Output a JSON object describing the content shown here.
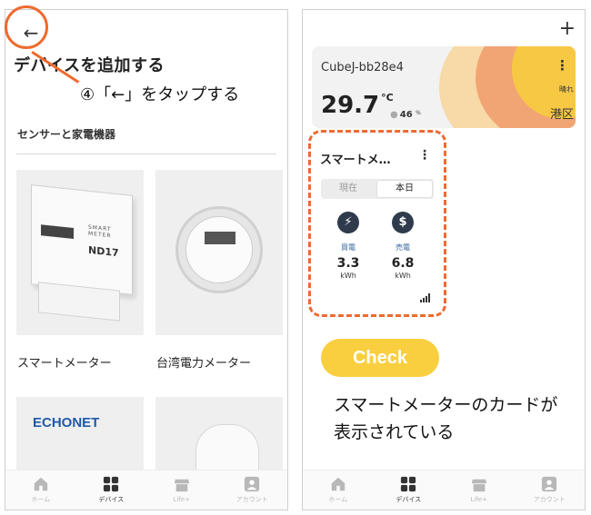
{
  "left": {
    "back_icon": "back-arrow-icon",
    "back_glyph": "←",
    "title": "デバイスを追加する",
    "section_title": "センサーと家電機器",
    "devices": [
      {
        "label": "スマートメーター",
        "image_text_top": "SMART",
        "image_text_mid": "METER",
        "image_model": "ND17"
      },
      {
        "label": "台湾電力メーター"
      },
      {
        "label": "",
        "logo_text": "ECHONET"
      },
      {
        "label": ""
      }
    ],
    "annotation": "④「←」をタップする",
    "nav": [
      {
        "label": "ホーム",
        "icon": "home-icon",
        "active": false
      },
      {
        "label": "デバイス",
        "icon": "devices-icon",
        "active": true
      },
      {
        "label": "Life+",
        "icon": "store-icon",
        "active": false
      },
      {
        "label": "アカウント",
        "icon": "account-icon",
        "active": false
      }
    ]
  },
  "right": {
    "add_glyph": "+",
    "weather": {
      "name": "CubeJ-bb28e4",
      "temp": "29.7",
      "unit": "°C",
      "humidity": "46",
      "humidity_unit": "%",
      "menu_glyph": "⋮",
      "weather": "晴れ",
      "area": "港区"
    },
    "meter_card": {
      "title": "スマートメ…",
      "menu_glyph": "⋮",
      "tab_now": "現在",
      "tab_today": "本日",
      "buy_label": "買電",
      "buy_value": "3.3",
      "buy_unit": "kWh",
      "sell_label": "売電",
      "sell_value": "6.8",
      "sell_unit": "kWh"
    },
    "check": "Check",
    "note": "スマートメーターのカードが表示されている",
    "nav": [
      {
        "label": "ホーム",
        "icon": "home-icon",
        "active": false
      },
      {
        "label": "デバイス",
        "icon": "devices-icon",
        "active": true
      },
      {
        "label": "Life+",
        "icon": "store-icon",
        "active": false
      },
      {
        "label": "アカウント",
        "icon": "account-icon",
        "active": false
      }
    ]
  },
  "colors": {
    "accent_orange": "#ef6a2f",
    "check_yellow": "#f9cf3f",
    "nav_active": "#333333",
    "nav_inactive": "#b8b8b8"
  }
}
